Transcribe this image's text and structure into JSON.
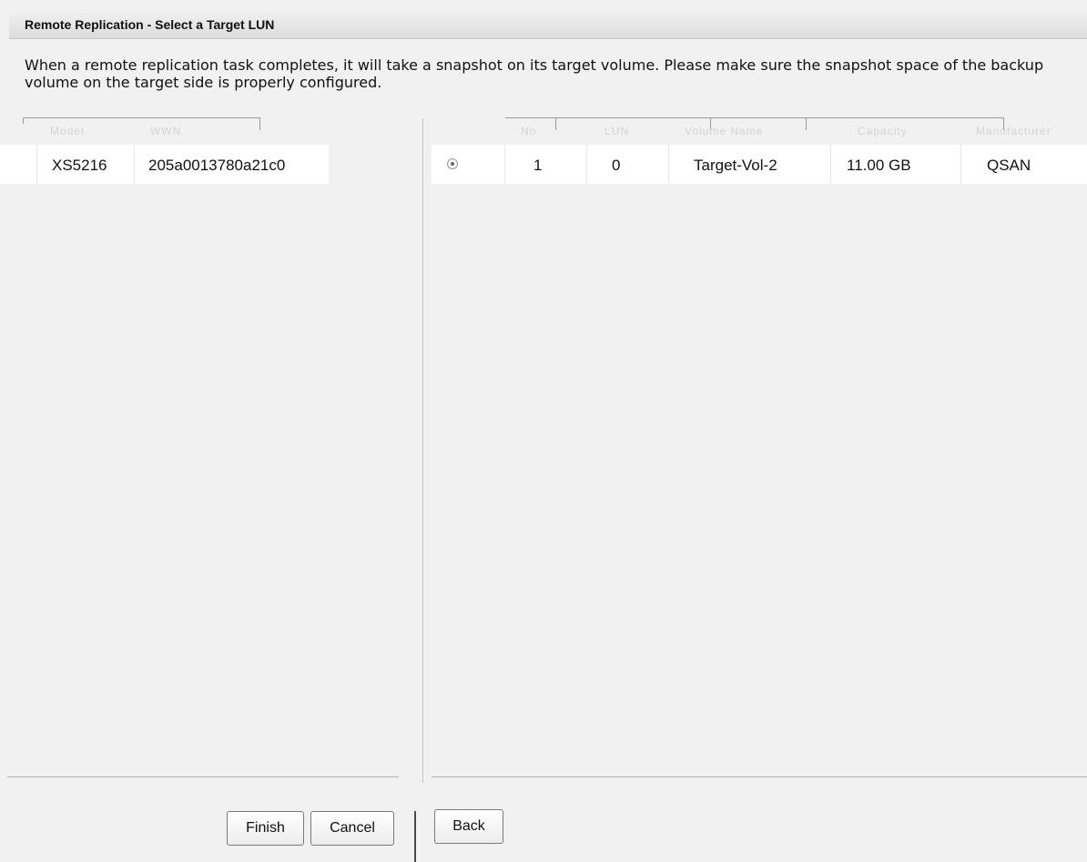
{
  "dialog": {
    "title": "Remote Replication - Select a Target LUN",
    "description": "When a remote replication task completes, it will take a snapshot on its target volume. Please make sure the snapshot space of the backup volume on the target side is properly configured."
  },
  "left_table": {
    "columns": [
      "Model",
      "WWN"
    ],
    "rows": [
      {
        "model": "XS5216",
        "wwn": "205a0013780a21c0"
      }
    ]
  },
  "right_table": {
    "columns": [
      "No.",
      "LUN",
      "Volume Name",
      "Capacity",
      "Manufacturer"
    ],
    "rows": [
      {
        "selected": true,
        "no": "1",
        "lun": "0",
        "volume_name": "Target-Vol-2",
        "capacity": "11.00 GB",
        "manufacturer": "QSAN"
      }
    ]
  },
  "buttons": {
    "finish": "Finish",
    "cancel": "Cancel",
    "back": "Back"
  }
}
